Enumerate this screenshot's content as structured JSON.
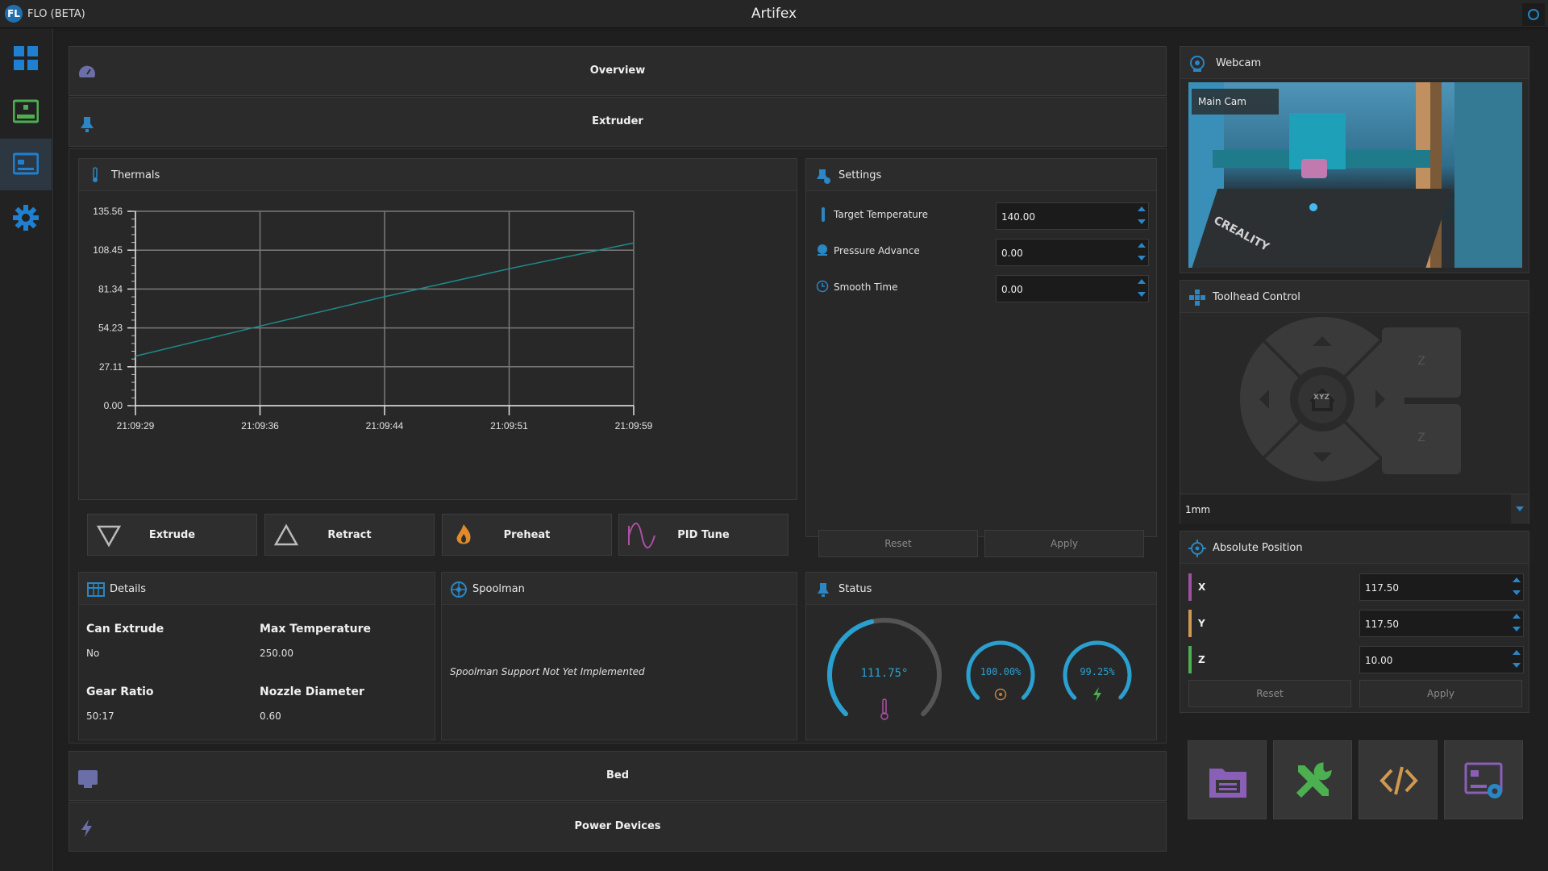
{
  "app": {
    "name": "FLO (BETA)",
    "window_title": "Artifex",
    "logo_text": "FL"
  },
  "sidebar": {
    "items": [
      {
        "name": "dashboard",
        "icon": "grid-icon"
      },
      {
        "name": "printer",
        "icon": "printer-icon"
      },
      {
        "name": "control",
        "icon": "monitor-icon",
        "active": true
      },
      {
        "name": "settings",
        "icon": "gear-icon"
      }
    ]
  },
  "sections": {
    "overview": "Overview",
    "extruder": "Extruder",
    "bed": "Bed",
    "power": "Power Devices"
  },
  "thermals": {
    "title": "Thermals",
    "chart_data": {
      "type": "line",
      "x": [
        "21:09:29",
        "21:09:36",
        "21:09:44",
        "21:09:51",
        "21:09:59"
      ],
      "series": [
        {
          "values": [
            34.5,
            55.5,
            76.0,
            95.5,
            113.5
          ],
          "color": "#1f8a8a"
        }
      ],
      "yticks": [
        "0.00",
        "27.11",
        "54.23",
        "81.34",
        "108.45",
        "135.56"
      ],
      "ylim": [
        0,
        135.56
      ],
      "grid": true
    }
  },
  "actions": {
    "extrude": "Extrude",
    "retract": "Retract",
    "preheat": "Preheat",
    "pid": "PID Tune"
  },
  "settings": {
    "title": "Settings",
    "target_label": "Target Temperature",
    "target_value": "140.00",
    "pa_label": "Pressure Advance",
    "pa_value": "0.00",
    "smooth_label": "Smooth Time",
    "smooth_value": "0.00",
    "reset": "Reset",
    "apply": "Apply"
  },
  "details": {
    "title": "Details",
    "can_extrude_label": "Can Extrude",
    "can_extrude_value": "No",
    "max_temp_label": "Max Temperature",
    "max_temp_value": "250.00",
    "gear_label": "Gear Ratio",
    "gear_value": "50:17",
    "nozzle_label": "Nozzle Diameter",
    "nozzle_value": "0.60"
  },
  "spoolman": {
    "title": "Spoolman",
    "message": "Spoolman Support Not Yet Implemented"
  },
  "status": {
    "title": "Status",
    "temp_text": "111.75°",
    "temp_fraction": 0.45,
    "fan_text": "100.00%",
    "fan_fraction": 1.0,
    "power_text": "99.25%",
    "power_fraction": 0.9925,
    "accent": "#2aa0d0"
  },
  "webcam": {
    "title": "Webcam",
    "camera_label": "Main Cam",
    "brand_text": "CREALITY"
  },
  "toolhead": {
    "title": "Toolhead Control",
    "step": "1mm",
    "home_label": "XYZ",
    "z_label": "Z"
  },
  "position": {
    "title": "Absolute Position",
    "x_label": "X",
    "x_value": "117.50",
    "y_label": "Y",
    "y_value": "117.50",
    "z_label": "Z",
    "z_value": "10.00",
    "reset": "Reset",
    "apply": "Apply"
  },
  "bottom_buttons": [
    "folder-print-icon",
    "tools-icon",
    "code-icon",
    "printer-settings-icon"
  ]
}
